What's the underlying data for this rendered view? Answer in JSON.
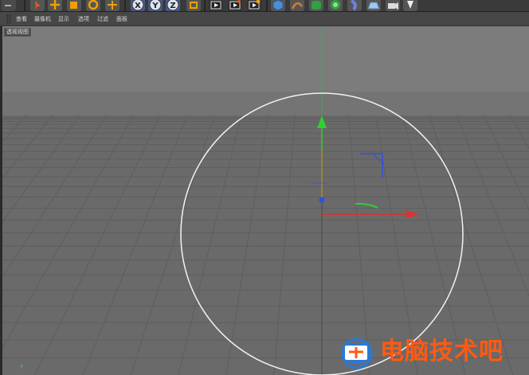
{
  "toolbar": {
    "buttons": [
      {
        "name": "undo-icon",
        "color": "#9a9a9a"
      },
      {
        "name": "selection-arrow-icon",
        "color": "#e05a1a"
      },
      {
        "name": "move-icon",
        "color": "#f0a000"
      },
      {
        "name": "scale-icon",
        "color": "#f0a000"
      },
      {
        "name": "rotate-icon",
        "color": "#f0a000"
      },
      {
        "name": "add-object-icon",
        "color": "#f0a000"
      },
      {
        "name": "x-axis-lock-icon",
        "label": "X"
      },
      {
        "name": "y-axis-lock-icon",
        "label": "Y"
      },
      {
        "name": "z-axis-lock-icon",
        "label": "Z"
      },
      {
        "name": "world-coordinates-icon",
        "color": "#f0a000"
      },
      {
        "name": "render-view-icon"
      },
      {
        "name": "render-to-picture-viewer-icon"
      },
      {
        "name": "render-settings-icon"
      },
      {
        "name": "cube-primitive-icon",
        "color": "#4a90d0"
      },
      {
        "name": "pen-spline-icon",
        "color": "#d08030"
      },
      {
        "name": "subdivision-icon",
        "color": "#30a040"
      },
      {
        "name": "cloner-icon",
        "color": "#30a040"
      },
      {
        "name": "deformer-icon",
        "color": "#7080e0"
      },
      {
        "name": "floor-icon",
        "color": "#a0c8f0"
      },
      {
        "name": "camera-icon",
        "color": "#dddddd"
      },
      {
        "name": "light-icon",
        "color": "#eeeeee"
      }
    ]
  },
  "menubar": {
    "items": [
      "查看",
      "摄像机",
      "显示",
      "选项",
      "过滤",
      "面板"
    ]
  },
  "viewport": {
    "label": "透视视图",
    "axis_label": "Y"
  },
  "watermark": {
    "text": "电脑技术吧"
  },
  "colors": {
    "background": "#6b6b6b",
    "horizon": "#7a7a7a",
    "grid_line": "#5a5a5a",
    "x_axis": "#e03030",
    "y_axis": "#30d030",
    "z_axis": "#3050e0",
    "circle": "#f2f2f2",
    "watermark": "#ff5a12"
  }
}
